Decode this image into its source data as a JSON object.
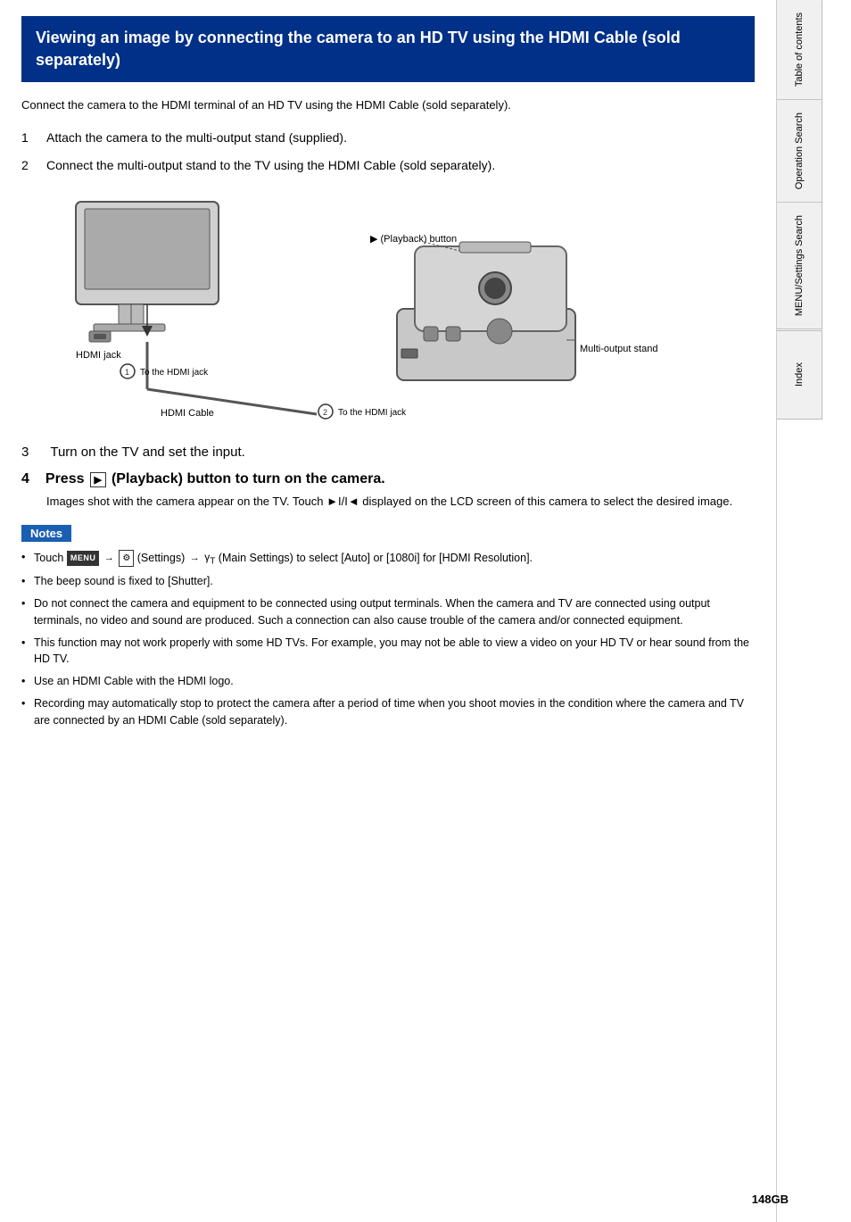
{
  "header": {
    "title": "Viewing an image by connecting the camera to an HD TV using the HDMI Cable (sold separately)"
  },
  "intro": "Connect the camera to the HDMI terminal of an HD TV using the HDMI Cable (sold separately).",
  "steps": [
    {
      "number": "1",
      "text": "Attach the camera to the multi-output stand (supplied)."
    },
    {
      "number": "2",
      "text": "Connect the multi-output stand to the TV using the HDMI Cable (sold separately)."
    },
    {
      "number": "3",
      "text": "Turn on the TV and set the input."
    },
    {
      "number": "4",
      "text": "Press",
      "text2": "(Playback) button to turn on the camera.",
      "subtext": "Images shot with the camera appear on the TV. Touch ►I/I◄ displayed on the LCD screen of this camera to select the desired image."
    }
  ],
  "diagram": {
    "hdmi_jack_label": "HDMI jack",
    "hdmi_cable_label": "HDMI Cable",
    "playback_btn_label": "(Playback) button",
    "multi_output_label": "Multi-output stand",
    "to_hdmi_1": "① To the HDMI jack",
    "to_hdmi_2": "② To the HDMI jack"
  },
  "notes": {
    "label": "Notes",
    "items": [
      "Touch MENU → ⚙ (Settings) → γT (Main Settings) to select [Auto] or [1080i] for [HDMI Resolution].",
      "The beep sound is fixed to [Shutter].",
      "Do not connect the camera and equipment to be connected using output terminals. When the camera and TV are connected using output terminals, no video and sound are produced. Such a connection can also cause trouble of the camera and/or connected equipment.",
      "This function may not work properly with some HD TVs. For example, you may not be able to view a video on your HD TV or hear sound from the HD TV.",
      "Use an HDMI Cable with the HDMI logo.",
      "Recording may automatically stop to protect the camera after a period of time when you shoot movies in the condition where the camera and TV are connected by an HDMI Cable (sold separately)."
    ]
  },
  "sidebar": {
    "tabs": [
      "Table of contents",
      "Operation Search",
      "MENU/Settings Search",
      "Index"
    ]
  },
  "page_number": "148GB"
}
